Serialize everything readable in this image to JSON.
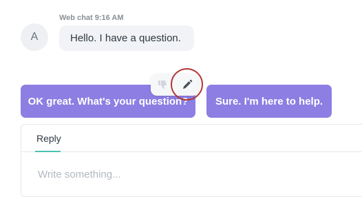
{
  "conversation": {
    "timestamp": "Web chat 9:16 AM",
    "avatar_initial": "A",
    "incoming_message": "Hello. I have a question."
  },
  "suggested_replies": [
    {
      "label": "OK great. What's your question?"
    },
    {
      "label": "Sure. I'm here to help."
    }
  ],
  "message_actions": {
    "icons": [
      "thumbs-down-icon",
      "pencil-icon"
    ]
  },
  "composer": {
    "tab_label": "Reply",
    "placeholder": "Write something..."
  },
  "colors": {
    "accent": "#8c7ee3",
    "tab_underline": "#4ac3b0",
    "highlight_ring": "#b03a36"
  }
}
